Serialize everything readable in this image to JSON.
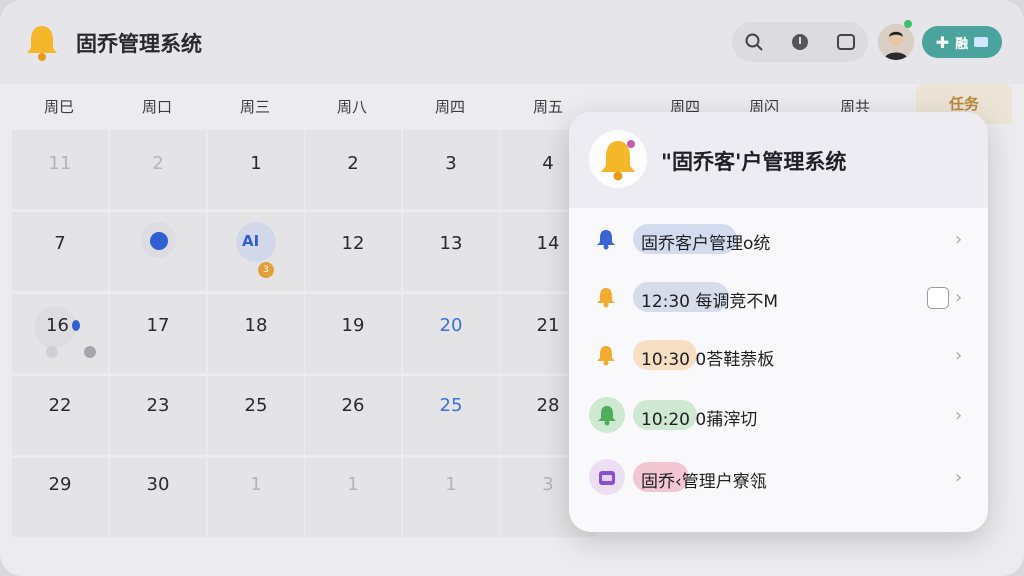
{
  "header": {
    "title": "固乔管理系统",
    "action_label": "融"
  },
  "calendar": {
    "weekdays": [
      "周巳",
      "周口",
      "周三",
      "周八",
      "周四",
      "周五",
      "",
      "周四",
      "周闪",
      "周共"
    ],
    "task_tab": "任务",
    "rows": [
      [
        "11",
        "2",
        "1",
        "2",
        "3",
        "4"
      ],
      [
        "7",
        "",
        "",
        "12",
        "13",
        "14"
      ],
      [
        "16",
        "17",
        "18",
        "19",
        "20",
        "21"
      ],
      [
        "22",
        "23",
        "25",
        "26",
        "25",
        "28"
      ],
      [
        "29",
        "30",
        "1",
        "1",
        "1",
        "3"
      ]
    ],
    "event_badge": "AI",
    "event_count": "3"
  },
  "popup": {
    "title": "\"固乔客'户管理系统",
    "items": [
      {
        "text": "固乔客户管理o统",
        "icon": "bell-icon",
        "accent": "#3b63d8",
        "pill": "#d3dcef"
      },
      {
        "text": "12:30 每调竞不M",
        "icon": "bell-icon",
        "accent": "#f0ad2e",
        "pill": "#d7dcea"
      },
      {
        "text": "10:30 0荅鞋萘板",
        "icon": "bell-icon",
        "accent": "#f0ad2e",
        "pill": "#f6dfc2"
      },
      {
        "text": "10:20 0蒱滓切",
        "icon": "bell-icon",
        "accent": "#4fae5b",
        "pill": "#cfe8d2"
      },
      {
        "text": "固乔‹管理户寮瓴",
        "icon": "calendar-icon",
        "accent": "#8a4fd6",
        "pill": "#f2c6d2"
      }
    ]
  },
  "colors": {
    "bell": "#f5b72a",
    "accent_teal": "#4aa39c",
    "blue_day": "#3b6fd6"
  }
}
